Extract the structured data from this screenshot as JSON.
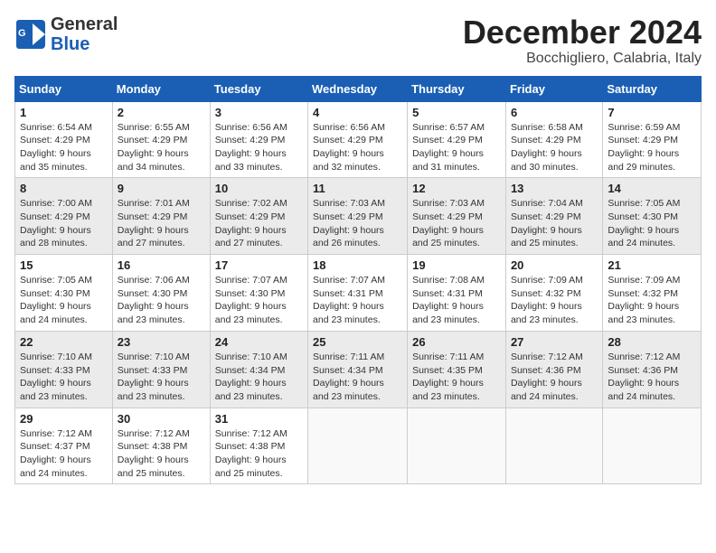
{
  "header": {
    "logo_line1": "General",
    "logo_line2": "Blue",
    "month": "December 2024",
    "location": "Bocchigliero, Calabria, Italy"
  },
  "weekdays": [
    "Sunday",
    "Monday",
    "Tuesday",
    "Wednesday",
    "Thursday",
    "Friday",
    "Saturday"
  ],
  "weeks": [
    [
      {
        "day": "1",
        "sunrise": "Sunrise: 6:54 AM",
        "sunset": "Sunset: 4:29 PM",
        "daylight": "Daylight: 9 hours and 35 minutes."
      },
      {
        "day": "2",
        "sunrise": "Sunrise: 6:55 AM",
        "sunset": "Sunset: 4:29 PM",
        "daylight": "Daylight: 9 hours and 34 minutes."
      },
      {
        "day": "3",
        "sunrise": "Sunrise: 6:56 AM",
        "sunset": "Sunset: 4:29 PM",
        "daylight": "Daylight: 9 hours and 33 minutes."
      },
      {
        "day": "4",
        "sunrise": "Sunrise: 6:56 AM",
        "sunset": "Sunset: 4:29 PM",
        "daylight": "Daylight: 9 hours and 32 minutes."
      },
      {
        "day": "5",
        "sunrise": "Sunrise: 6:57 AM",
        "sunset": "Sunset: 4:29 PM",
        "daylight": "Daylight: 9 hours and 31 minutes."
      },
      {
        "day": "6",
        "sunrise": "Sunrise: 6:58 AM",
        "sunset": "Sunset: 4:29 PM",
        "daylight": "Daylight: 9 hours and 30 minutes."
      },
      {
        "day": "7",
        "sunrise": "Sunrise: 6:59 AM",
        "sunset": "Sunset: 4:29 PM",
        "daylight": "Daylight: 9 hours and 29 minutes."
      }
    ],
    [
      {
        "day": "8",
        "sunrise": "Sunrise: 7:00 AM",
        "sunset": "Sunset: 4:29 PM",
        "daylight": "Daylight: 9 hours and 28 minutes."
      },
      {
        "day": "9",
        "sunrise": "Sunrise: 7:01 AM",
        "sunset": "Sunset: 4:29 PM",
        "daylight": "Daylight: 9 hours and 27 minutes."
      },
      {
        "day": "10",
        "sunrise": "Sunrise: 7:02 AM",
        "sunset": "Sunset: 4:29 PM",
        "daylight": "Daylight: 9 hours and 27 minutes."
      },
      {
        "day": "11",
        "sunrise": "Sunrise: 7:03 AM",
        "sunset": "Sunset: 4:29 PM",
        "daylight": "Daylight: 9 hours and 26 minutes."
      },
      {
        "day": "12",
        "sunrise": "Sunrise: 7:03 AM",
        "sunset": "Sunset: 4:29 PM",
        "daylight": "Daylight: 9 hours and 25 minutes."
      },
      {
        "day": "13",
        "sunrise": "Sunrise: 7:04 AM",
        "sunset": "Sunset: 4:29 PM",
        "daylight": "Daylight: 9 hours and 25 minutes."
      },
      {
        "day": "14",
        "sunrise": "Sunrise: 7:05 AM",
        "sunset": "Sunset: 4:30 PM",
        "daylight": "Daylight: 9 hours and 24 minutes."
      }
    ],
    [
      {
        "day": "15",
        "sunrise": "Sunrise: 7:05 AM",
        "sunset": "Sunset: 4:30 PM",
        "daylight": "Daylight: 9 hours and 24 minutes."
      },
      {
        "day": "16",
        "sunrise": "Sunrise: 7:06 AM",
        "sunset": "Sunset: 4:30 PM",
        "daylight": "Daylight: 9 hours and 23 minutes."
      },
      {
        "day": "17",
        "sunrise": "Sunrise: 7:07 AM",
        "sunset": "Sunset: 4:30 PM",
        "daylight": "Daylight: 9 hours and 23 minutes."
      },
      {
        "day": "18",
        "sunrise": "Sunrise: 7:07 AM",
        "sunset": "Sunset: 4:31 PM",
        "daylight": "Daylight: 9 hours and 23 minutes."
      },
      {
        "day": "19",
        "sunrise": "Sunrise: 7:08 AM",
        "sunset": "Sunset: 4:31 PM",
        "daylight": "Daylight: 9 hours and 23 minutes."
      },
      {
        "day": "20",
        "sunrise": "Sunrise: 7:09 AM",
        "sunset": "Sunset: 4:32 PM",
        "daylight": "Daylight: 9 hours and 23 minutes."
      },
      {
        "day": "21",
        "sunrise": "Sunrise: 7:09 AM",
        "sunset": "Sunset: 4:32 PM",
        "daylight": "Daylight: 9 hours and 23 minutes."
      }
    ],
    [
      {
        "day": "22",
        "sunrise": "Sunrise: 7:10 AM",
        "sunset": "Sunset: 4:33 PM",
        "daylight": "Daylight: 9 hours and 23 minutes."
      },
      {
        "day": "23",
        "sunrise": "Sunrise: 7:10 AM",
        "sunset": "Sunset: 4:33 PM",
        "daylight": "Daylight: 9 hours and 23 minutes."
      },
      {
        "day": "24",
        "sunrise": "Sunrise: 7:10 AM",
        "sunset": "Sunset: 4:34 PM",
        "daylight": "Daylight: 9 hours and 23 minutes."
      },
      {
        "day": "25",
        "sunrise": "Sunrise: 7:11 AM",
        "sunset": "Sunset: 4:34 PM",
        "daylight": "Daylight: 9 hours and 23 minutes."
      },
      {
        "day": "26",
        "sunrise": "Sunrise: 7:11 AM",
        "sunset": "Sunset: 4:35 PM",
        "daylight": "Daylight: 9 hours and 23 minutes."
      },
      {
        "day": "27",
        "sunrise": "Sunrise: 7:12 AM",
        "sunset": "Sunset: 4:36 PM",
        "daylight": "Daylight: 9 hours and 24 minutes."
      },
      {
        "day": "28",
        "sunrise": "Sunrise: 7:12 AM",
        "sunset": "Sunset: 4:36 PM",
        "daylight": "Daylight: 9 hours and 24 minutes."
      }
    ],
    [
      {
        "day": "29",
        "sunrise": "Sunrise: 7:12 AM",
        "sunset": "Sunset: 4:37 PM",
        "daylight": "Daylight: 9 hours and 24 minutes."
      },
      {
        "day": "30",
        "sunrise": "Sunrise: 7:12 AM",
        "sunset": "Sunset: 4:38 PM",
        "daylight": "Daylight: 9 hours and 25 minutes."
      },
      {
        "day": "31",
        "sunrise": "Sunrise: 7:12 AM",
        "sunset": "Sunset: 4:38 PM",
        "daylight": "Daylight: 9 hours and 25 minutes."
      },
      null,
      null,
      null,
      null
    ]
  ]
}
